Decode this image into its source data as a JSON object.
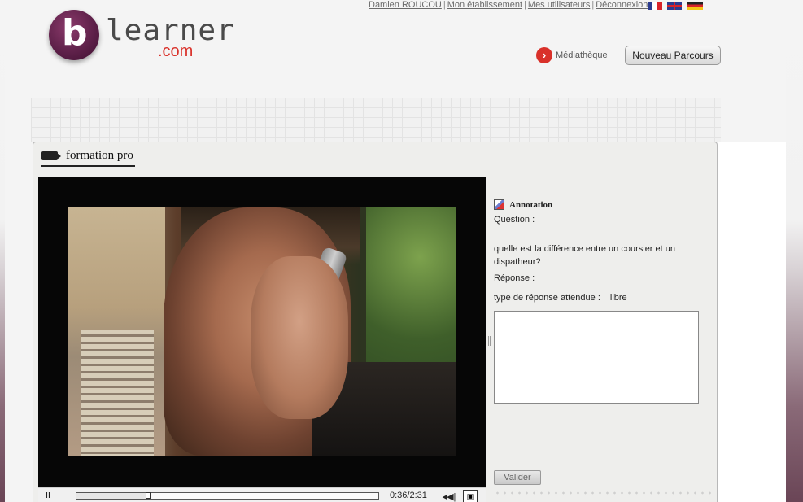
{
  "logo": {
    "letter": "b",
    "word": "learner",
    "suffix": ".com"
  },
  "top_links": {
    "user": "Damien ROUCOU",
    "establishment": "Mon établissement",
    "users": "Mes utilisateurs",
    "logout": "Déconnexion",
    "separator": "|"
  },
  "flags": [
    "fr-flag-icon",
    "uk-flag-icon",
    "de-flag-icon"
  ],
  "header_nav": {
    "mediatheque_label": "Médiathèque",
    "mediatheque_icon": "arrow-right-icon",
    "new_parcours_label": "Nouveau Parcours"
  },
  "panel": {
    "title": "formation pro",
    "icon": "film-icon"
  },
  "player": {
    "pause_symbol": "II",
    "time": "0:36/2:31",
    "progress_fraction": 0.238,
    "volume_symbol": "◂◀|",
    "fullscreen_symbol": "▣"
  },
  "annotation": {
    "title": "Annotation",
    "question_label": "Question :",
    "question_text": "quelle est la différence entre un coursier et un dispatheur?",
    "response_label": "Réponse :",
    "response_type_label": "type de réponse attendue :",
    "response_type_value": "libre",
    "answer_value": "",
    "submit_label": "Valider"
  },
  "colors": {
    "brand_purple": "#5b1f47",
    "brand_red": "#d9312a"
  }
}
